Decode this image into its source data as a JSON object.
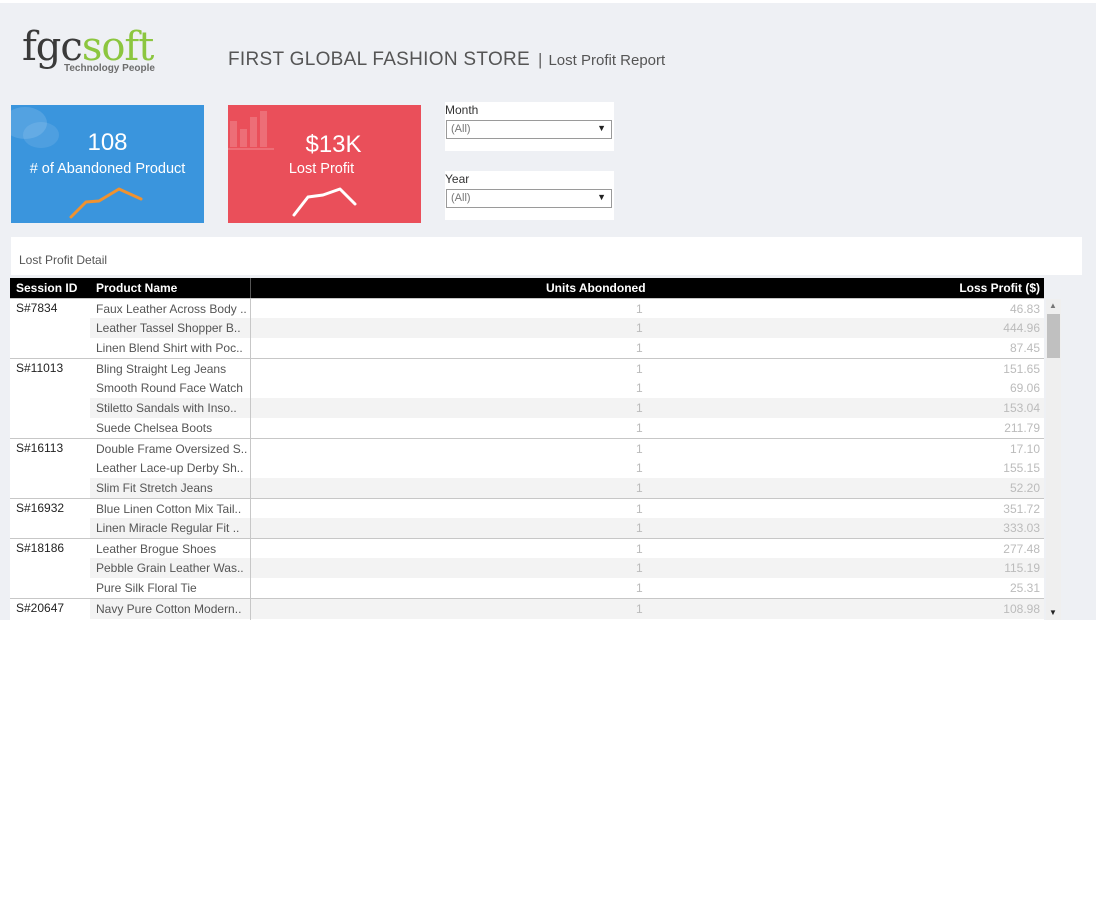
{
  "logo": {
    "fgc": "fgc",
    "soft": "soft",
    "tagline": "Technology People"
  },
  "header": {
    "title": "FIRST GLOBAL FASHION STORE",
    "separator": "|",
    "subtitle": "Lost Profit Report"
  },
  "kpis": {
    "abandoned": {
      "value": "108",
      "label": "# of Abandoned Product",
      "color": "#3a95dd"
    },
    "lost_profit": {
      "value": "$13K",
      "label": "Lost Profit",
      "color": "#ea4f5a"
    }
  },
  "filters": {
    "month": {
      "label": "Month",
      "value": "(All)"
    },
    "year": {
      "label": "Year",
      "value": "(All)"
    }
  },
  "section": {
    "title": "Lost Profit Detail"
  },
  "table": {
    "headers": {
      "session": "Session ID",
      "product": "Product Name",
      "units": "Units Abondoned",
      "loss": "Loss Profit ($)"
    },
    "rows": [
      {
        "session": "S#7834",
        "product": "Faux Leather Across Body ..",
        "units": "1",
        "loss": "46.83"
      },
      {
        "session": "",
        "product": "Leather Tassel Shopper B..",
        "units": "1",
        "loss": "444.96"
      },
      {
        "session": "",
        "product": "Linen Blend Shirt with Poc..",
        "units": "1",
        "loss": "87.45"
      },
      {
        "session": "S#11013",
        "product": "Bling Straight Leg Jeans",
        "units": "1",
        "loss": "151.65"
      },
      {
        "session": "",
        "product": "Smooth Round Face Watch",
        "units": "1",
        "loss": "69.06"
      },
      {
        "session": "",
        "product": "Stiletto Sandals with Inso..",
        "units": "1",
        "loss": "153.04"
      },
      {
        "session": "",
        "product": "Suede Chelsea Boots",
        "units": "1",
        "loss": "211.79"
      },
      {
        "session": "S#16113",
        "product": "Double Frame Oversized S..",
        "units": "1",
        "loss": "17.10"
      },
      {
        "session": "",
        "product": "Leather Lace-up Derby Sh..",
        "units": "1",
        "loss": "155.15"
      },
      {
        "session": "",
        "product": "Slim Fit Stretch Jeans",
        "units": "1",
        "loss": "52.20"
      },
      {
        "session": "S#16932",
        "product": "Blue Linen Cotton Mix Tail..",
        "units": "1",
        "loss": "351.72"
      },
      {
        "session": "",
        "product": "Linen Miracle Regular Fit ..",
        "units": "1",
        "loss": "333.03"
      },
      {
        "session": "S#18186",
        "product": "Leather Brogue Shoes",
        "units": "1",
        "loss": "277.48"
      },
      {
        "session": "",
        "product": "Pebble Grain Leather Was..",
        "units": "1",
        "loss": "115.19"
      },
      {
        "session": "",
        "product": "Pure Silk Floral Tie",
        "units": "1",
        "loss": "25.31"
      },
      {
        "session": "S#20647",
        "product": "Navy Pure Cotton Modern..",
        "units": "1",
        "loss": "108.98"
      }
    ]
  },
  "icons": {
    "scroll_up": "▲",
    "scroll_down": "▼",
    "dropdown": "▼"
  }
}
